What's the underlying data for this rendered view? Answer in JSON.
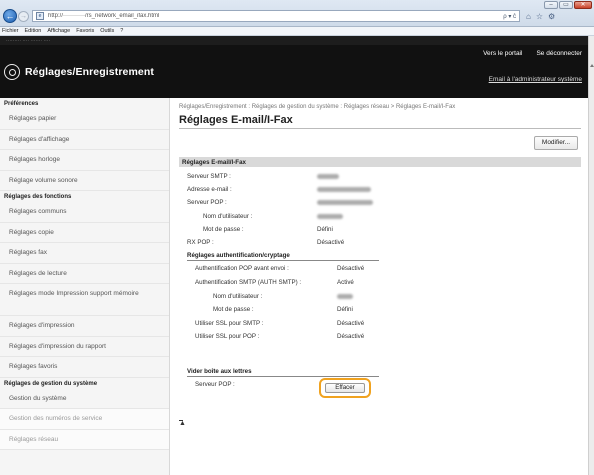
{
  "browser": {
    "address": "http://···········/rs_network_email_ifax.html",
    "address_tools": "ρ ▾ ĉ",
    "menu": [
      "Fichier",
      "Edition",
      "Affichage",
      "Favoris",
      "Outils",
      "?"
    ],
    "window_buttons": [
      "–",
      "▭",
      "✕"
    ]
  },
  "header": {
    "topline": "·········  ····  ·······  ····",
    "title": "Réglages/Enregistrement",
    "portal_link": "Vers le portail",
    "logout_link": "Se déconnecter",
    "admin_email_link": "Email à l'administrateur système"
  },
  "sidebar": {
    "sections": [
      {
        "title": "Préférences",
        "items": [
          "Réglages papier",
          "Réglages d'affichage",
          "Réglages horloge",
          "Réglage volume sonore"
        ]
      },
      {
        "title": "Réglages des fonctions",
        "items": [
          "Réglages communs",
          "Réglages copie",
          "Réglages fax",
          "Réglages de lecture",
          "Réglages mode Impression support mémoire",
          "Réglages d'impression",
          "Réglages d'impression du rapport",
          "Réglages favoris"
        ]
      },
      {
        "title": "Réglages de gestion du système",
        "items": [
          "Gestion du système",
          "Gestion des numéros de service",
          "Réglages réseau"
        ]
      }
    ]
  },
  "main": {
    "breadcrumb": "Réglages/Enregistrement : Réglages de gestion du système : Réglages réseau > Réglages E-mail/I-Fax",
    "title": "Réglages E-mail/I-Fax",
    "modify_button": "Modifier...",
    "section_title": "Réglages E-mail/I-Fax",
    "fields": {
      "smtp_server": "Serveur SMTP :",
      "email_address": "Adresse e-mail :",
      "pop_server": "Serveur POP :",
      "user_name": "Nom d'utilisateur :",
      "password": "Mot de passe :",
      "password_value": "Défini",
      "rx_pop": "RX POP :",
      "rx_pop_value": "Désactivé"
    },
    "auth_section": {
      "title": "Réglages authentification/cryptage",
      "pop_before_send": "Authentification POP avant envoi :",
      "pop_before_send_value": "Désactivé",
      "smtp_auth": "Authentification SMTP (AUTH SMTP) :",
      "smtp_auth_value": "Activé",
      "user_name": "Nom d'utilisateur :",
      "password": "Mot de passe :",
      "password_value": "Défini",
      "ssl_smtp": "Utiliser SSL pour SMTP :",
      "ssl_smtp_value": "Désactivé",
      "ssl_pop": "Utiliser SSL pour POP :",
      "ssl_pop_value": "Désactivé"
    },
    "clear_section": {
      "title": "Vider boîte aux lettres",
      "pop_server": "Serveur POP :",
      "erase_button": "Effacer"
    },
    "top_link": "▲"
  },
  "colors": {
    "header_bg": "#111111",
    "highlight_ring": "#f0a21f",
    "section_bar": "#d9d9d9"
  }
}
